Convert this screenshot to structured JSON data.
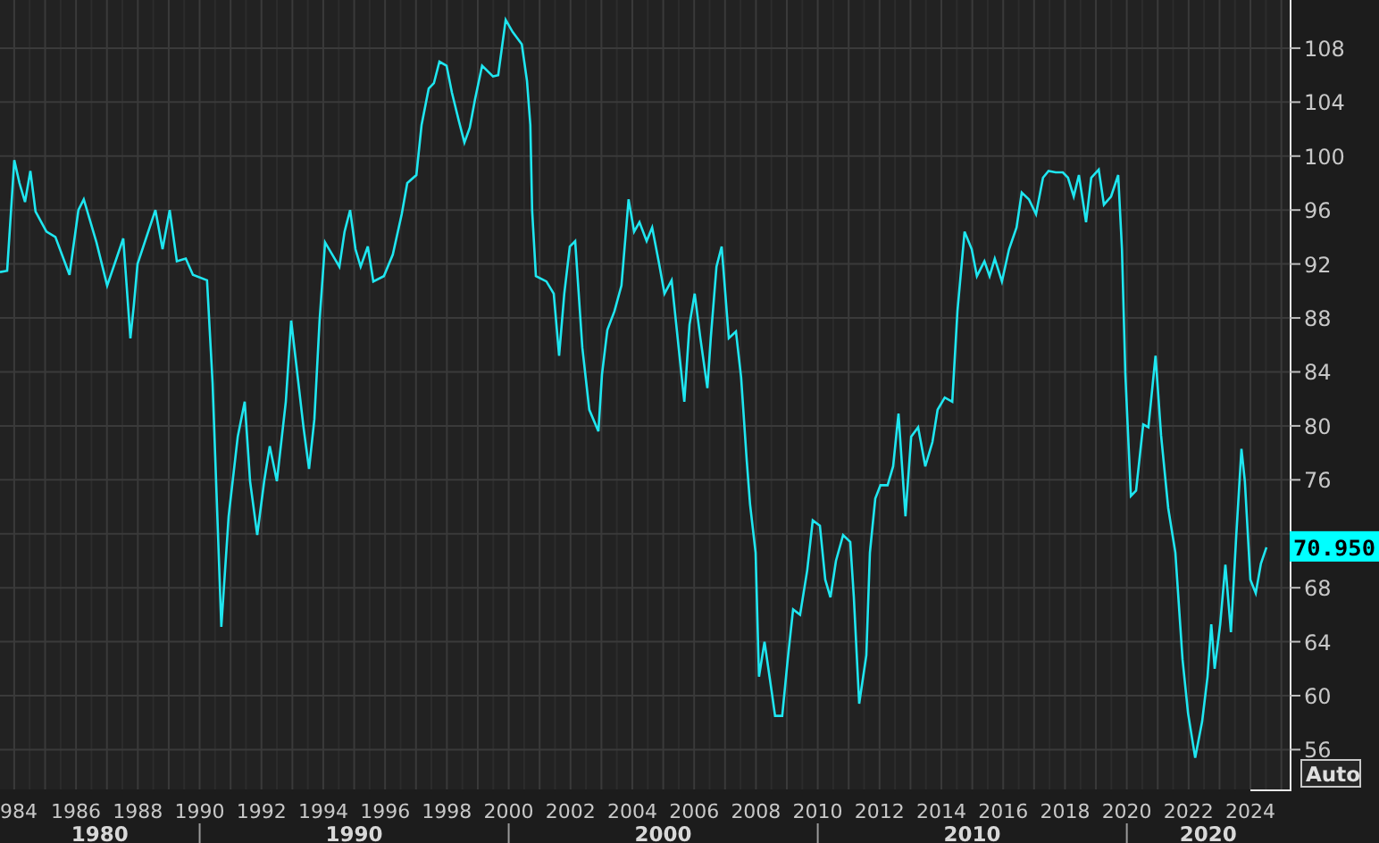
{
  "chart": {
    "chart_data": {
      "type": "line",
      "xlim": [
        1983.54,
        2025.27
      ],
      "ylim": [
        53.05,
        111.57
      ],
      "grid": true,
      "xticks": [
        1986,
        1988,
        1990,
        1992,
        1994,
        1996,
        1998,
        2000,
        2002,
        2004,
        2006,
        2008,
        2010,
        2012,
        2014,
        2016,
        2018,
        2020,
        2022,
        2024
      ],
      "yticks": [
        56,
        60,
        64,
        68,
        76,
        80,
        84,
        88,
        92,
        96,
        100,
        104,
        108
      ],
      "x": [
        1983.54,
        1983.77,
        1984.0,
        1984.17,
        1984.35,
        1984.52,
        1984.69,
        1985.04,
        1985.33,
        1985.79,
        1986.08,
        1986.25,
        1986.66,
        1987.01,
        1987.53,
        1987.76,
        1987.87,
        1987.99,
        1988.57,
        1988.8,
        1989.03,
        1989.26,
        1989.55,
        1989.78,
        1990.24,
        1990.42,
        1990.7,
        1990.94,
        1991.23,
        1991.46,
        1991.63,
        1991.86,
        1992.09,
        1992.27,
        1992.5,
        1992.79,
        1992.96,
        1993.13,
        1993.36,
        1993.54,
        1993.71,
        1993.88,
        1994.06,
        1994.52,
        1994.69,
        1994.87,
        1995.04,
        1995.21,
        1995.44,
        1995.62,
        1995.96,
        1996.25,
        1996.54,
        1996.72,
        1997.01,
        1997.18,
        1997.41,
        1997.58,
        1997.76,
        1997.99,
        1998.16,
        1998.39,
        1998.57,
        1998.74,
        1998.91,
        1999.14,
        1999.49,
        1999.66,
        1999.9,
        2000.13,
        2000.42,
        2000.59,
        2000.7,
        2000.76,
        2000.88,
        2001.22,
        2001.46,
        2001.63,
        2001.8,
        2001.98,
        2002.15,
        2002.38,
        2002.61,
        2002.9,
        2003.02,
        2003.19,
        2003.42,
        2003.65,
        2003.88,
        2004.06,
        2004.23,
        2004.46,
        2004.64,
        2004.87,
        2005.04,
        2005.27,
        2005.44,
        2005.68,
        2005.85,
        2006.02,
        2006.2,
        2006.43,
        2006.54,
        2006.72,
        2006.89,
        2007.12,
        2007.35,
        2007.52,
        2007.7,
        2007.81,
        2007.99,
        2008.1,
        2008.28,
        2008.51,
        2008.62,
        2008.85,
        2009.03,
        2009.2,
        2009.43,
        2009.66,
        2009.84,
        2010.07,
        2010.24,
        2010.41,
        2010.59,
        2010.82,
        2011.05,
        2011.17,
        2011.34,
        2011.57,
        2011.69,
        2011.86,
        2012.03,
        2012.26,
        2012.44,
        2012.61,
        2012.84,
        2013.02,
        2013.25,
        2013.48,
        2013.71,
        2013.88,
        2014.11,
        2014.35,
        2014.52,
        2014.75,
        2014.98,
        2015.15,
        2015.39,
        2015.56,
        2015.73,
        2015.96,
        2016.19,
        2016.43,
        2016.6,
        2016.83,
        2017.06,
        2017.29,
        2017.47,
        2017.7,
        2017.93,
        2018.1,
        2018.28,
        2018.45,
        2018.68,
        2018.85,
        2019.09,
        2019.26,
        2019.49,
        2019.72,
        2019.84,
        2019.95,
        2020.13,
        2020.3,
        2020.53,
        2020.7,
        2020.93,
        2021.11,
        2021.34,
        2021.57,
        2021.8,
        2021.98,
        2022.21,
        2022.44,
        2022.61,
        2022.73,
        2022.84,
        2023.02,
        2023.19,
        2023.37,
        2023.54,
        2023.71,
        2023.82,
        2024.0,
        2024.17,
        2024.34,
        2024.52
      ],
      "series": [
        {
          "color": "#1fe6f0",
          "values": [
            91.4,
            91.5,
            99.7,
            98.0,
            96.6,
            98.9,
            95.9,
            94.4,
            94.0,
            91.2,
            96.0,
            96.8,
            93.6,
            90.4,
            93.9,
            86.5,
            88.9,
            92.0,
            96.0,
            93.1,
            96.0,
            92.2,
            92.4,
            91.2,
            90.8,
            83.2,
            65.1,
            73.3,
            79.2,
            81.8,
            75.9,
            71.9,
            75.9,
            78.5,
            75.9,
            81.8,
            87.8,
            84.5,
            79.9,
            76.8,
            80.5,
            87.8,
            93.6,
            91.8,
            94.4,
            96.0,
            93.1,
            91.8,
            93.3,
            90.7,
            91.1,
            92.7,
            95.7,
            98.0,
            98.6,
            102.3,
            105.0,
            105.4,
            107.0,
            106.7,
            104.7,
            102.6,
            101.0,
            102.1,
            104.2,
            106.7,
            105.9,
            106.0,
            110.1,
            109.2,
            108.3,
            105.6,
            102.3,
            96.0,
            91.1,
            90.7,
            89.8,
            85.2,
            89.8,
            93.3,
            93.7,
            85.8,
            81.2,
            79.6,
            83.8,
            87.1,
            88.5,
            90.4,
            96.8,
            94.4,
            95.1,
            93.7,
            94.7,
            92.0,
            89.8,
            90.8,
            87.1,
            81.8,
            87.5,
            89.8,
            86.5,
            82.8,
            86.5,
            91.8,
            93.3,
            86.5,
            87.0,
            83.6,
            77.5,
            74.2,
            70.6,
            61.4,
            64.0,
            60.3,
            58.5,
            58.5,
            62.7,
            66.4,
            66.0,
            69.3,
            73.0,
            72.6,
            68.6,
            67.3,
            70.0,
            71.9,
            71.4,
            67.3,
            59.4,
            63.0,
            70.6,
            74.6,
            75.6,
            75.6,
            77.0,
            80.9,
            73.3,
            79.2,
            79.9,
            77.0,
            78.8,
            81.2,
            82.1,
            81.8,
            88.5,
            94.4,
            93.1,
            91.1,
            92.2,
            91.1,
            92.4,
            90.7,
            93.1,
            94.7,
            97.3,
            96.8,
            95.7,
            98.4,
            98.9,
            98.8,
            98.8,
            98.4,
            97.0,
            98.6,
            95.1,
            98.4,
            99.0,
            96.4,
            97.0,
            98.6,
            93.1,
            83.8,
            74.8,
            75.2,
            80.1,
            79.9,
            85.2,
            79.3,
            73.9,
            70.6,
            62.7,
            58.7,
            55.4,
            58.1,
            61.4,
            65.3,
            62.0,
            65.3,
            69.7,
            64.7,
            71.9,
            78.3,
            75.9,
            68.6,
            67.6,
            69.8,
            71.0
          ]
        }
      ]
    },
    "decade_labels": [
      "1980",
      "1990",
      "2000",
      "2010",
      "2020"
    ],
    "left_edge_xtick_label": "984",
    "last_value": "70.950",
    "auto_button": "Auto"
  }
}
